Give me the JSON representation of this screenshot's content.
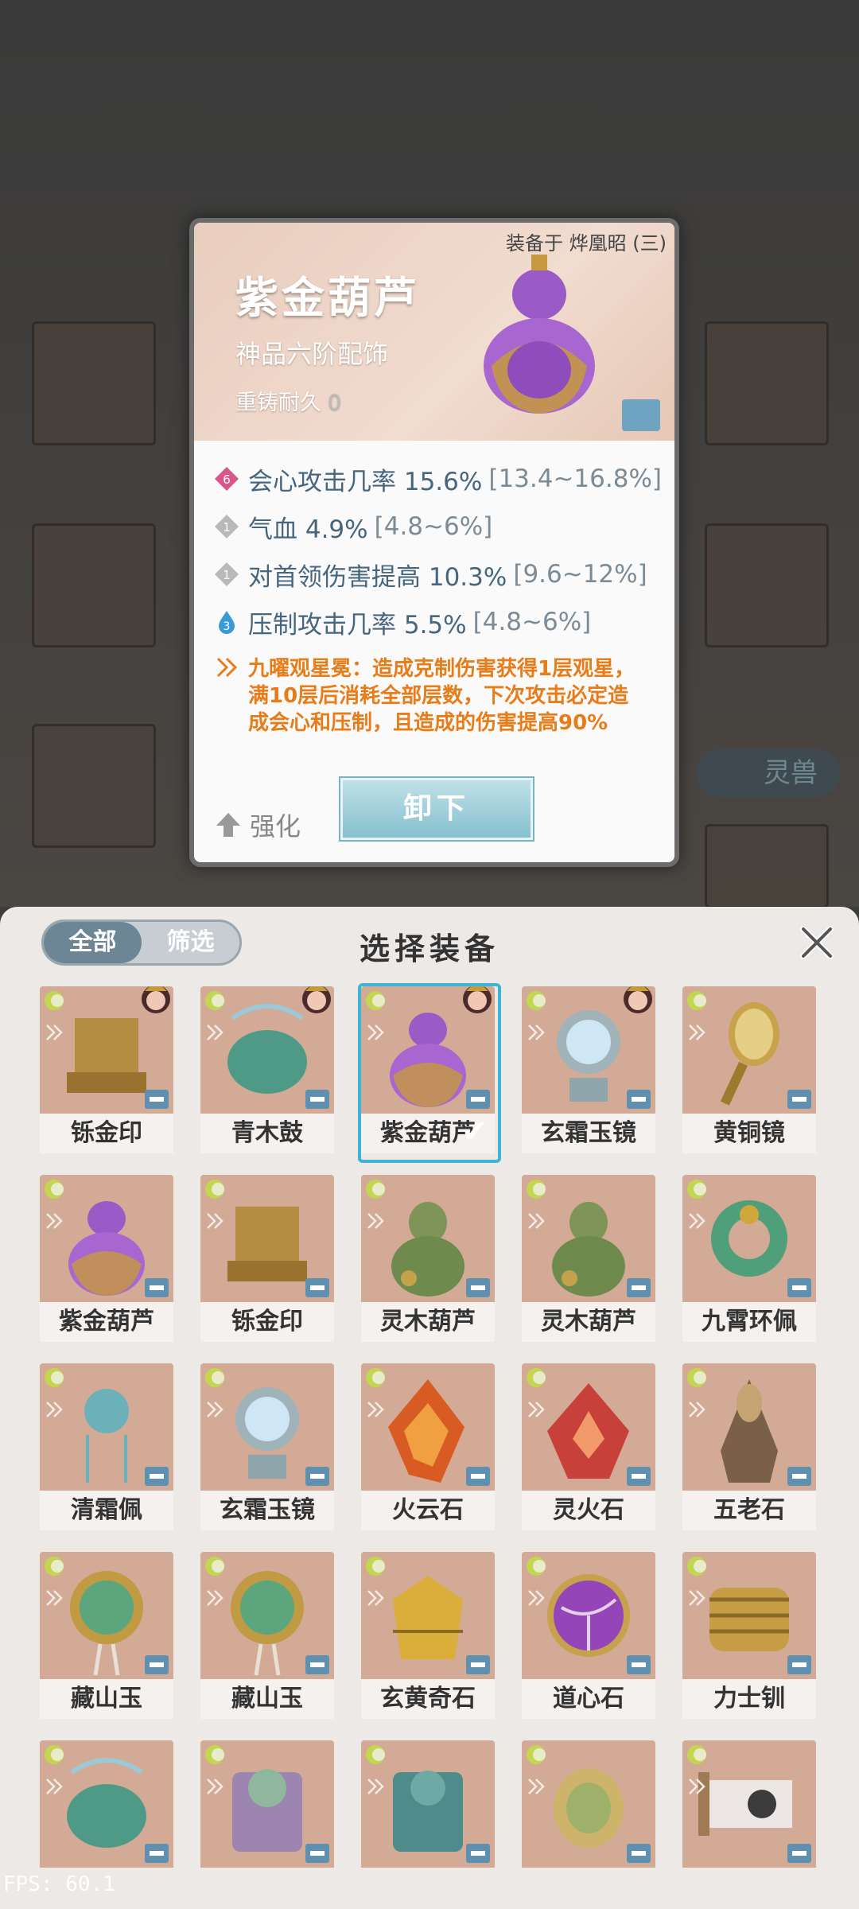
{
  "detail": {
    "equipped_on": "装备于 烨凰昭 (三)",
    "name": "紫金葫芦",
    "subtitle": "神品六阶配饰",
    "reforge_label": "重铸耐久",
    "reforge_value": "0",
    "stats": [
      {
        "badge": "6",
        "badge_color": "#d9568a",
        "text": "会心攻击几率 15.6%",
        "range": "[13.4~16.8%]"
      },
      {
        "badge": "1",
        "badge_color": "#b9b9b9",
        "text": "气血 4.9%",
        "range": "[4.8~6%]"
      },
      {
        "badge": "1",
        "badge_color": "#b9b9b9",
        "text": "对首领伤害提高 10.3%",
        "range": "[9.6~12%]"
      },
      {
        "badge": "3",
        "badge_color": "#3a9ad8",
        "text": "压制攻击几率 5.5%",
        "range": "[4.8~6%]"
      }
    ],
    "set_effect": "九曜观星冕：造成克制伤害获得1层观星，满10层后消耗全部层数，下次攻击必定造成会心和压制，且造成的伤害提高90%",
    "enhance_label": "强化",
    "unequip_label": "卸下"
  },
  "panel": {
    "title": "选择装备",
    "tabs": [
      "全部",
      "筛选"
    ],
    "active_tab": 0
  },
  "items": [
    {
      "name": "铄金印",
      "kind": "seal",
      "owned_by_hero": true
    },
    {
      "name": "青木鼓",
      "kind": "drum",
      "owned_by_hero": true
    },
    {
      "name": "紫金葫芦",
      "kind": "gourd",
      "owned_by_hero": true,
      "selected": true
    },
    {
      "name": "玄霜玉镜",
      "kind": "mirror",
      "owned_by_hero": true
    },
    {
      "name": "黄铜镜",
      "kind": "handmirror"
    },
    {
      "name": "紫金葫芦",
      "kind": "gourd"
    },
    {
      "name": "铄金印",
      "kind": "seal"
    },
    {
      "name": "灵木葫芦",
      "kind": "greengourd"
    },
    {
      "name": "灵木葫芦",
      "kind": "greengourd"
    },
    {
      "name": "九霄环佩",
      "kind": "ring"
    },
    {
      "name": "清霜佩",
      "kind": "pendant"
    },
    {
      "name": "玄霜玉镜",
      "kind": "mirror"
    },
    {
      "name": "火云石",
      "kind": "firestone"
    },
    {
      "name": "灵火石",
      "kind": "redstone"
    },
    {
      "name": "五老石",
      "kind": "ore"
    },
    {
      "name": "藏山玉",
      "kind": "jade"
    },
    {
      "name": "藏山玉",
      "kind": "jade"
    },
    {
      "name": "玄黄奇石",
      "kind": "goldore"
    },
    {
      "name": "道心石",
      "kind": "orb"
    },
    {
      "name": "力士钏",
      "kind": "bracelet"
    },
    {
      "name": "",
      "kind": "drum"
    },
    {
      "name": "",
      "kind": "purple"
    },
    {
      "name": "",
      "kind": "teal"
    },
    {
      "name": "",
      "kind": "amulet"
    },
    {
      "name": "",
      "kind": "scroll"
    }
  ],
  "background": {
    "side_tag": "灵兽"
  },
  "fps": "FPS: 60.1"
}
